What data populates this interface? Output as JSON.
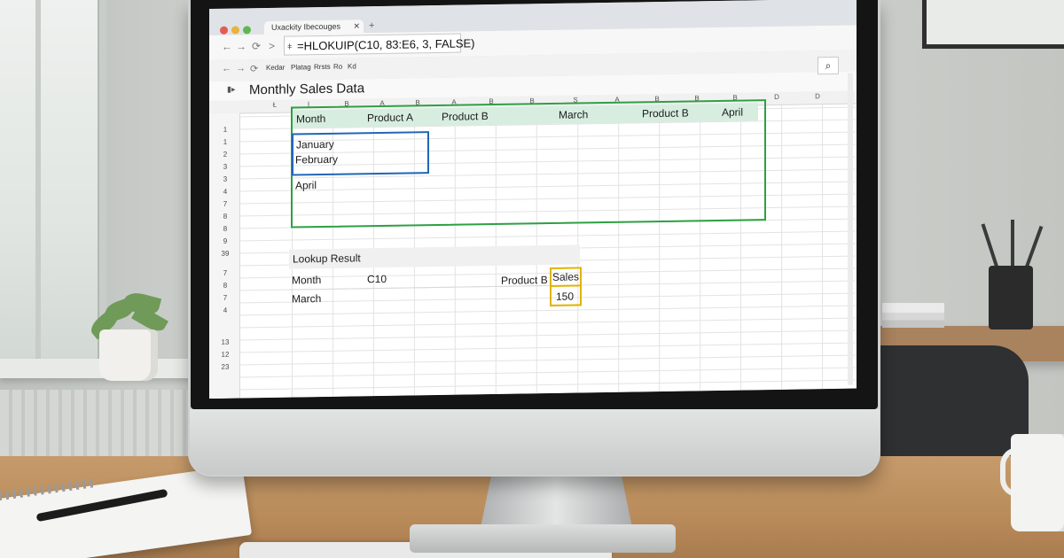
{
  "browser": {
    "tab_title": "Uxackity Ibecouges",
    "tab_close": "✕",
    "new_tab": "+",
    "formula": "=HLOKUIP(C10, 83:E6, 3, FALSE)",
    "formula_icon": "fx-icon",
    "nav_back": "←",
    "nav_forward": "→",
    "nav_reload": "⟳",
    "nav_chevron": ">"
  },
  "toolbar": {
    "items": [
      "Kedar",
      "Platag",
      "Rrsts",
      "Ro",
      "Kd"
    ]
  },
  "sheet": {
    "title": "Monthly Sales Data",
    "search_icon": "⌕",
    "column_headers": [
      "Ł",
      "I",
      "B",
      "A",
      "B",
      "A",
      "B",
      "B",
      "S",
      "A",
      "B",
      "B",
      "B",
      "D",
      "D"
    ],
    "row_headers": [
      "1",
      "1",
      "2",
      "3",
      "3",
      "4",
      "7",
      "8",
      "8",
      "9",
      "39",
      "7",
      "8",
      "7",
      "4",
      "13",
      "12",
      "23"
    ],
    "table_headers": [
      "Month",
      "Product A",
      "Product B",
      "March",
      "Product B",
      "April"
    ],
    "months": [
      "January",
      "February",
      "April"
    ],
    "lookup": {
      "title": "Lookup Result",
      "month_label": "Month",
      "cell_ref": "C10",
      "product_label": "Product B",
      "sales_label": "Sales",
      "month_value": "March",
      "sales_value": "150"
    }
  },
  "colors": {
    "green_highlight": "#2ea043",
    "blue_highlight": "#2166b7",
    "yellow_highlight": "#e0b400",
    "header_band": "#d7ede0"
  }
}
